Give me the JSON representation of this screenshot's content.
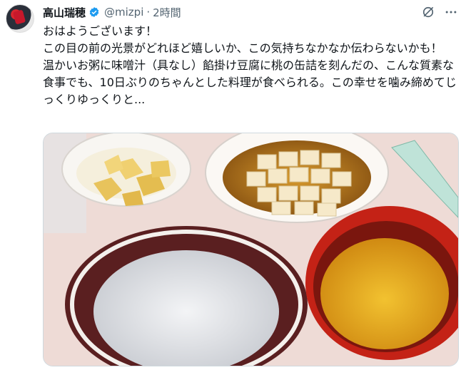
{
  "tweet": {
    "author_name": "高山瑞穂",
    "handle": "@mizpi",
    "separator": "·",
    "time": "2時間",
    "lines": [
      "おはようございます！",
      "この目の前の光景がどれほど嬉しいか、この気持ちなかなか伝わらないかも！",
      "温かいお粥に味噌汁（具なし）餡掛け豆腐に桃の缶詰を刻んだの、こんな質素な食事でも、10日ぶりのちゃんとした料理が食べられる。この幸せを噛み締めてじっくりゆっくりと..."
    ]
  },
  "icons": {
    "verified": "verified-badge-icon",
    "grok": "grok-icon",
    "more": "more-options-icon"
  },
  "colors": {
    "verified": "#1d9bf0",
    "secondary_text": "#536471"
  }
}
